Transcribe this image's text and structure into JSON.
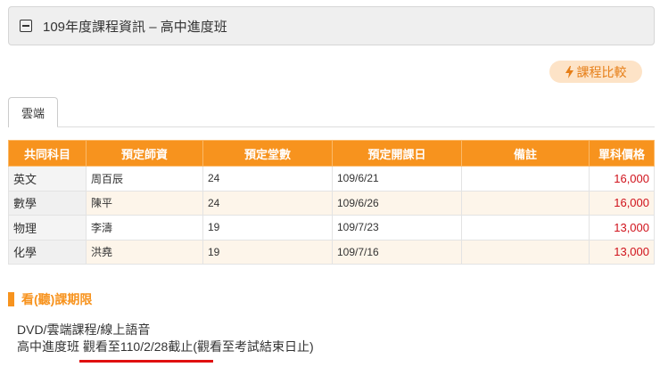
{
  "header": {
    "title": "109年度課程資訊 – 高中進度班"
  },
  "compare_button": {
    "label": "課程比較",
    "icon": "lightning-icon"
  },
  "tabs": [
    {
      "label": "雲端"
    }
  ],
  "table": {
    "columns": [
      "共同科目",
      "預定師資",
      "預定堂數",
      "預定開課日",
      "備註",
      "單科價格"
    ],
    "rows": [
      [
        "英文",
        "周百辰",
        "24",
        "109/6/21",
        "",
        "16,000"
      ],
      [
        "數學",
        "陳平",
        "24",
        "109/6/26",
        "",
        "16,000"
      ],
      [
        "物理",
        "李濤",
        "19",
        "109/7/23",
        "",
        "13,000"
      ],
      [
        "化學",
        "洪堯",
        "19",
        "109/7/16",
        "",
        "13,000"
      ]
    ]
  },
  "viewing": {
    "title": "看(聽)課期限",
    "line1": "DVD/雲端課程/線上語音",
    "line2_prefix": "高中進度班 ",
    "line2_highlight": "觀看至110/2/28截止",
    "line2_suffix": "(觀看至考試結束日止)"
  },
  "colors": {
    "accent": "#f7931e",
    "price": "#d0121b",
    "underline": "#e01010"
  }
}
